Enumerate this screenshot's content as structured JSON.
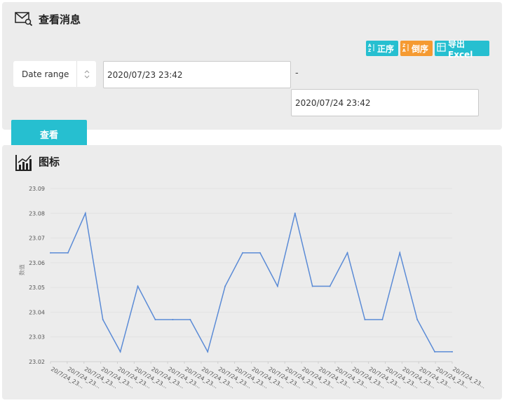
{
  "query_panel": {
    "title": "查看消息",
    "sort_asc_label": "正序",
    "sort_desc_label": "倒序",
    "export_label": "导出Excel",
    "range_select_value": "Date range",
    "date_start": "2020/07/23 23:42",
    "date_end": "2020/07/24 23:42",
    "range_separator": "-",
    "query_button_label": "查看"
  },
  "chart_panel": {
    "title": "图标"
  },
  "colors": {
    "accent": "#26bfd0",
    "orange": "#f59a31",
    "line": "#5b8bd6"
  },
  "chart_data": {
    "type": "line",
    "ylabel": "数值",
    "xlabel": "",
    "ylim": [
      23.02,
      23.09
    ],
    "yticks": [
      "23.02",
      "23.03",
      "23.04",
      "23.05",
      "23.06",
      "23.07",
      "23.08",
      "23.09"
    ],
    "x": [
      "20/7/24_23...",
      "20/7/24_23...",
      "20/7/24_23...",
      "20/7/24_23...",
      "20/7/24_23...",
      "20/7/24_23...",
      "20/7/24_23...",
      "20/7/24_23...",
      "20/7/24_23...",
      "20/7/24_23...",
      "20/7/24_23...",
      "20/7/24_23...",
      "20/7/24_23...",
      "20/7/24_23...",
      "20/7/24_23...",
      "20/7/24_23...",
      "20/7/24_23...",
      "20/7/24_23...",
      "20/7/24_23...",
      "20/7/24_23...",
      "20/7/24_23...",
      "20/7/24_23...",
      "20/7/24_23...",
      "20/7/24_23...",
      "20/7/24_23..."
    ],
    "series": [
      {
        "values": [
          23.064,
          23.064,
          23.08,
          23.037,
          23.024,
          23.0505,
          23.037,
          23.037,
          23.037,
          23.024,
          23.0505,
          23.064,
          23.064,
          23.0505,
          23.08,
          23.0505,
          23.0505,
          23.064,
          23.037,
          23.037,
          23.064,
          23.037,
          23.024,
          23.024
        ]
      }
    ],
    "grid": true,
    "legend": "none"
  }
}
